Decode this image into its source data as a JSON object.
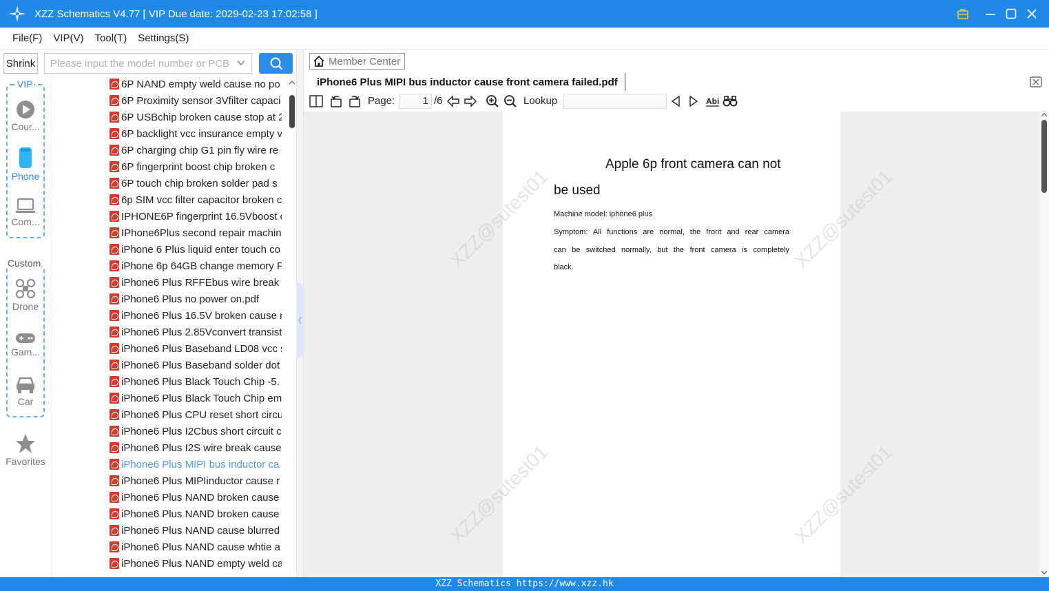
{
  "window": {
    "title": "XZZ Schematics V4.77 [ VIP Due date: 2029-02-23 17:02:58 ]",
    "accent": "#1e8ae6"
  },
  "menu": [
    "File(F)",
    "VIP(V)",
    "Tool(T)",
    "Settings(S)"
  ],
  "toolbar": {
    "shrink_label": "Shrink",
    "search_placeholder": "Please input the model number or PCB",
    "search_icon": "search-icon"
  },
  "sidebar": {
    "vip_label": "VIP",
    "custom_label": "Custom",
    "items": [
      {
        "label": "Cour...",
        "icon": "play-circle-icon"
      },
      {
        "label": "Phone",
        "icon": "phone-icon"
      },
      {
        "label": "Com...",
        "icon": "laptop-icon"
      },
      {
        "label": "Drone",
        "icon": "drone-icon"
      },
      {
        "label": "Gam...",
        "icon": "gamepad-icon"
      },
      {
        "label": "Car",
        "icon": "car-icon"
      },
      {
        "label": "Favorites",
        "icon": "star-icon"
      }
    ]
  },
  "files": [
    "6P NAND empty weld cause no po",
    "6P Proximity sensor 3Vfilter capaci",
    "6P USBchip broken cause stop at 2",
    "6P backlight vcc insurance empty v",
    "6P charging chip G1 pin fly wire re",
    "6P fingerprint boost chip broken c",
    "6P touch chip broken solder pad s",
    "6p SIM vcc filter capacitor broken c",
    "IPHONE6P fingerprint 16.5Vboost c",
    "IPhone6Plus second repair machin",
    "iPhone 6 Plus liquid enter touch co",
    "iPhone 6p 64GB change memory F",
    "iPhone6 Plus  RFFEbus wire break",
    "iPhone6 Plus  no power on.pdf",
    "iPhone6 Plus 16.5V broken cause r",
    "iPhone6 Plus 2.85Vconvert transist",
    "iPhone6 Plus Baseband LD08 vcc s",
    "iPhone6 Plus Baseband solder dot",
    "iPhone6 Plus Black Touch Chip -5.",
    "iPhone6 Plus Black Touch Chip em",
    "iPhone6 Plus CPU reset short circu",
    "iPhone6 Plus I2Cbus short circuit c",
    "iPhone6 Plus I2S wire break  cause",
    "iPhone6 Plus MIPI bus inductor ca",
    "iPhone6 Plus MIPIinductor cause r",
    "iPhone6 Plus NAND broken cause",
    "iPhone6 Plus NAND broken cause",
    "iPhone6 Plus NAND cause blurred",
    "iPhone6 Plus NAND cause whtie a",
    "iPhone6 Plus NAND empty weld ca"
  ],
  "selected_file_index": 23,
  "viewer": {
    "member_center": "Member Center",
    "doc_title": "iPhone6 Plus MIPI bus inductor cause front camera failed.pdf",
    "page_label": "Page:",
    "page_current": "1",
    "page_total": "/6",
    "lookup_label": "Lookup",
    "lookup_value": ""
  },
  "document": {
    "title_line1": "Apple 6p front camera can not",
    "title_line2": "be used",
    "model_line": "Machine model: iphone6 plus",
    "symptom_lines": [
      "Symptom: All functions are normal, the front and rear camera",
      "can be switched normally, but the front camera is completely",
      "black."
    ],
    "watermark": "XZZ@sutest01"
  },
  "statusbar": "XZZ Schematics https://www.xzz.hk"
}
